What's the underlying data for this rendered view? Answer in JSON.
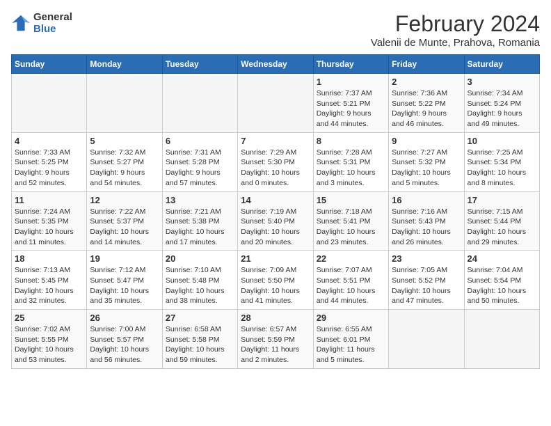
{
  "logo": {
    "general": "General",
    "blue": "Blue"
  },
  "title": "February 2024",
  "subtitle": "Valenii de Munte, Prahova, Romania",
  "weekdays": [
    "Sunday",
    "Monday",
    "Tuesday",
    "Wednesday",
    "Thursday",
    "Friday",
    "Saturday"
  ],
  "weeks": [
    [
      {
        "day": "",
        "info": ""
      },
      {
        "day": "",
        "info": ""
      },
      {
        "day": "",
        "info": ""
      },
      {
        "day": "",
        "info": ""
      },
      {
        "day": "1",
        "info": "Sunrise: 7:37 AM\nSunset: 5:21 PM\nDaylight: 9 hours\nand 44 minutes."
      },
      {
        "day": "2",
        "info": "Sunrise: 7:36 AM\nSunset: 5:22 PM\nDaylight: 9 hours\nand 46 minutes."
      },
      {
        "day": "3",
        "info": "Sunrise: 7:34 AM\nSunset: 5:24 PM\nDaylight: 9 hours\nand 49 minutes."
      }
    ],
    [
      {
        "day": "4",
        "info": "Sunrise: 7:33 AM\nSunset: 5:25 PM\nDaylight: 9 hours\nand 52 minutes."
      },
      {
        "day": "5",
        "info": "Sunrise: 7:32 AM\nSunset: 5:27 PM\nDaylight: 9 hours\nand 54 minutes."
      },
      {
        "day": "6",
        "info": "Sunrise: 7:31 AM\nSunset: 5:28 PM\nDaylight: 9 hours\nand 57 minutes."
      },
      {
        "day": "7",
        "info": "Sunrise: 7:29 AM\nSunset: 5:30 PM\nDaylight: 10 hours\nand 0 minutes."
      },
      {
        "day": "8",
        "info": "Sunrise: 7:28 AM\nSunset: 5:31 PM\nDaylight: 10 hours\nand 3 minutes."
      },
      {
        "day": "9",
        "info": "Sunrise: 7:27 AM\nSunset: 5:32 PM\nDaylight: 10 hours\nand 5 minutes."
      },
      {
        "day": "10",
        "info": "Sunrise: 7:25 AM\nSunset: 5:34 PM\nDaylight: 10 hours\nand 8 minutes."
      }
    ],
    [
      {
        "day": "11",
        "info": "Sunrise: 7:24 AM\nSunset: 5:35 PM\nDaylight: 10 hours\nand 11 minutes."
      },
      {
        "day": "12",
        "info": "Sunrise: 7:22 AM\nSunset: 5:37 PM\nDaylight: 10 hours\nand 14 minutes."
      },
      {
        "day": "13",
        "info": "Sunrise: 7:21 AM\nSunset: 5:38 PM\nDaylight: 10 hours\nand 17 minutes."
      },
      {
        "day": "14",
        "info": "Sunrise: 7:19 AM\nSunset: 5:40 PM\nDaylight: 10 hours\nand 20 minutes."
      },
      {
        "day": "15",
        "info": "Sunrise: 7:18 AM\nSunset: 5:41 PM\nDaylight: 10 hours\nand 23 minutes."
      },
      {
        "day": "16",
        "info": "Sunrise: 7:16 AM\nSunset: 5:43 PM\nDaylight: 10 hours\nand 26 minutes."
      },
      {
        "day": "17",
        "info": "Sunrise: 7:15 AM\nSunset: 5:44 PM\nDaylight: 10 hours\nand 29 minutes."
      }
    ],
    [
      {
        "day": "18",
        "info": "Sunrise: 7:13 AM\nSunset: 5:45 PM\nDaylight: 10 hours\nand 32 minutes."
      },
      {
        "day": "19",
        "info": "Sunrise: 7:12 AM\nSunset: 5:47 PM\nDaylight: 10 hours\nand 35 minutes."
      },
      {
        "day": "20",
        "info": "Sunrise: 7:10 AM\nSunset: 5:48 PM\nDaylight: 10 hours\nand 38 minutes."
      },
      {
        "day": "21",
        "info": "Sunrise: 7:09 AM\nSunset: 5:50 PM\nDaylight: 10 hours\nand 41 minutes."
      },
      {
        "day": "22",
        "info": "Sunrise: 7:07 AM\nSunset: 5:51 PM\nDaylight: 10 hours\nand 44 minutes."
      },
      {
        "day": "23",
        "info": "Sunrise: 7:05 AM\nSunset: 5:52 PM\nDaylight: 10 hours\nand 47 minutes."
      },
      {
        "day": "24",
        "info": "Sunrise: 7:04 AM\nSunset: 5:54 PM\nDaylight: 10 hours\nand 50 minutes."
      }
    ],
    [
      {
        "day": "25",
        "info": "Sunrise: 7:02 AM\nSunset: 5:55 PM\nDaylight: 10 hours\nand 53 minutes."
      },
      {
        "day": "26",
        "info": "Sunrise: 7:00 AM\nSunset: 5:57 PM\nDaylight: 10 hours\nand 56 minutes."
      },
      {
        "day": "27",
        "info": "Sunrise: 6:58 AM\nSunset: 5:58 PM\nDaylight: 10 hours\nand 59 minutes."
      },
      {
        "day": "28",
        "info": "Sunrise: 6:57 AM\nSunset: 5:59 PM\nDaylight: 11 hours\nand 2 minutes."
      },
      {
        "day": "29",
        "info": "Sunrise: 6:55 AM\nSunset: 6:01 PM\nDaylight: 11 hours\nand 5 minutes."
      },
      {
        "day": "",
        "info": ""
      },
      {
        "day": "",
        "info": ""
      }
    ]
  ]
}
